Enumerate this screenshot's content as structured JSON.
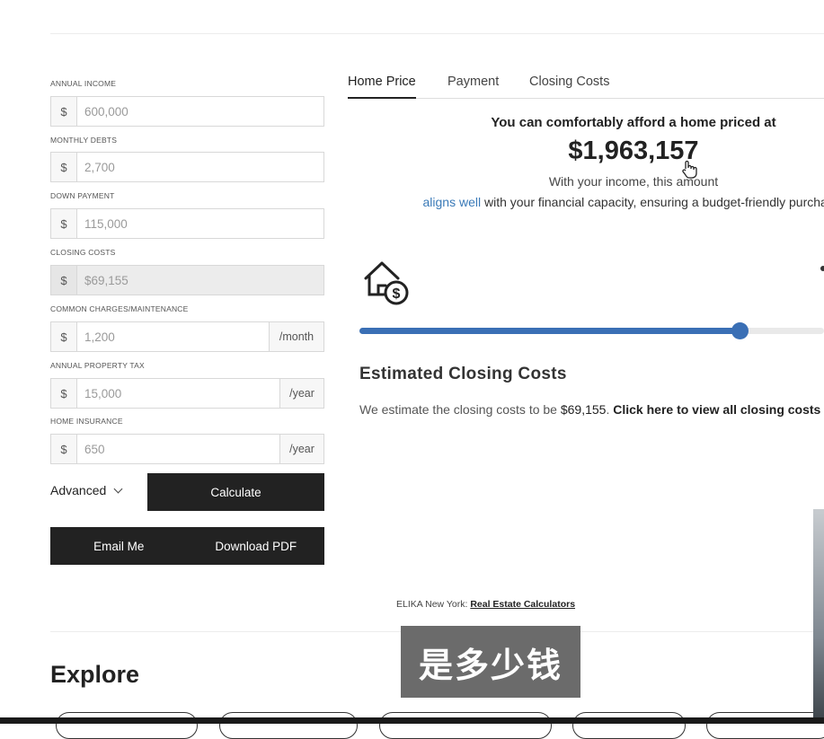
{
  "form": {
    "annual_income": {
      "label": "ANNUAL INCOME",
      "prefix": "$",
      "value": "600,000"
    },
    "monthly_debts": {
      "label": "MONTHLY DEBTS",
      "prefix": "$",
      "value": "2,700"
    },
    "down_payment": {
      "label": "DOWN PAYMENT",
      "prefix": "$",
      "value": "115,000"
    },
    "closing_costs": {
      "label": "CLOSING COSTS",
      "prefix": "$",
      "value": "$69,155"
    },
    "common_charges": {
      "label": "COMMON CHARGES/MAINTENANCE",
      "prefix": "$",
      "value": "1,200",
      "suffix": "/month"
    },
    "property_tax": {
      "label": "ANNUAL PROPERTY TAX",
      "prefix": "$",
      "value": "15,000",
      "suffix": "/year"
    },
    "home_insurance": {
      "label": "HOME INSURANCE",
      "prefix": "$",
      "value": "650",
      "suffix": "/year"
    },
    "advanced_label": "Advanced",
    "calculate_label": "Calculate",
    "email_label": "Email Me",
    "download_label": "Download PDF"
  },
  "tabs": [
    {
      "label": "Home Price",
      "active": true
    },
    {
      "label": "Payment",
      "active": false
    },
    {
      "label": "Closing Costs",
      "active": false
    }
  ],
  "result": {
    "headline": "You can comfortably afford a home priced at",
    "price": "$1,963,157",
    "subline": "With your income, this amount",
    "highlight": "aligns well",
    "rest": " with your financial capacity, ensuring a budget-friendly purchase."
  },
  "slider": {
    "fraction": 0.818
  },
  "estimate": {
    "title": "Estimated Closing Costs",
    "text_prefix": "We estimate the closing costs to be ",
    "amount": "$69,155",
    "text_dot": ". ",
    "link": "Click here to view all closing costs"
  },
  "footer": {
    "credit_prefix": "ELIKA New York: ",
    "credit_link": "Real Estate Calculators"
  },
  "explore": {
    "title": "Explore"
  },
  "overlay": {
    "caption": "是多少钱"
  },
  "colors": {
    "accent": "#3a6fb5",
    "dark": "#222222",
    "link": "#3a7ab8"
  },
  "icons": [
    "house-dollar-icon",
    "chevron-down-icon",
    "hand-cursor-icon"
  ]
}
